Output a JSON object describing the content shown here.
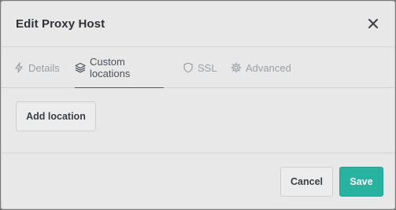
{
  "modal": {
    "title": "Edit Proxy Host",
    "close_icon": "close-icon"
  },
  "tabs": [
    {
      "label": "Details",
      "icon": "lightning-icon",
      "active": false
    },
    {
      "label": "Custom locations",
      "icon": "layers-icon",
      "active": true
    },
    {
      "label": "SSL",
      "icon": "shield-icon",
      "active": false
    },
    {
      "label": "Advanced",
      "icon": "gear-icon",
      "active": false
    }
  ],
  "content": {
    "add_location_label": "Add location"
  },
  "footer": {
    "cancel_label": "Cancel",
    "save_label": "Save"
  },
  "colors": {
    "accent": "#27b3a0",
    "background": "#e8e8e8",
    "overlay": "#7a7a7a"
  }
}
